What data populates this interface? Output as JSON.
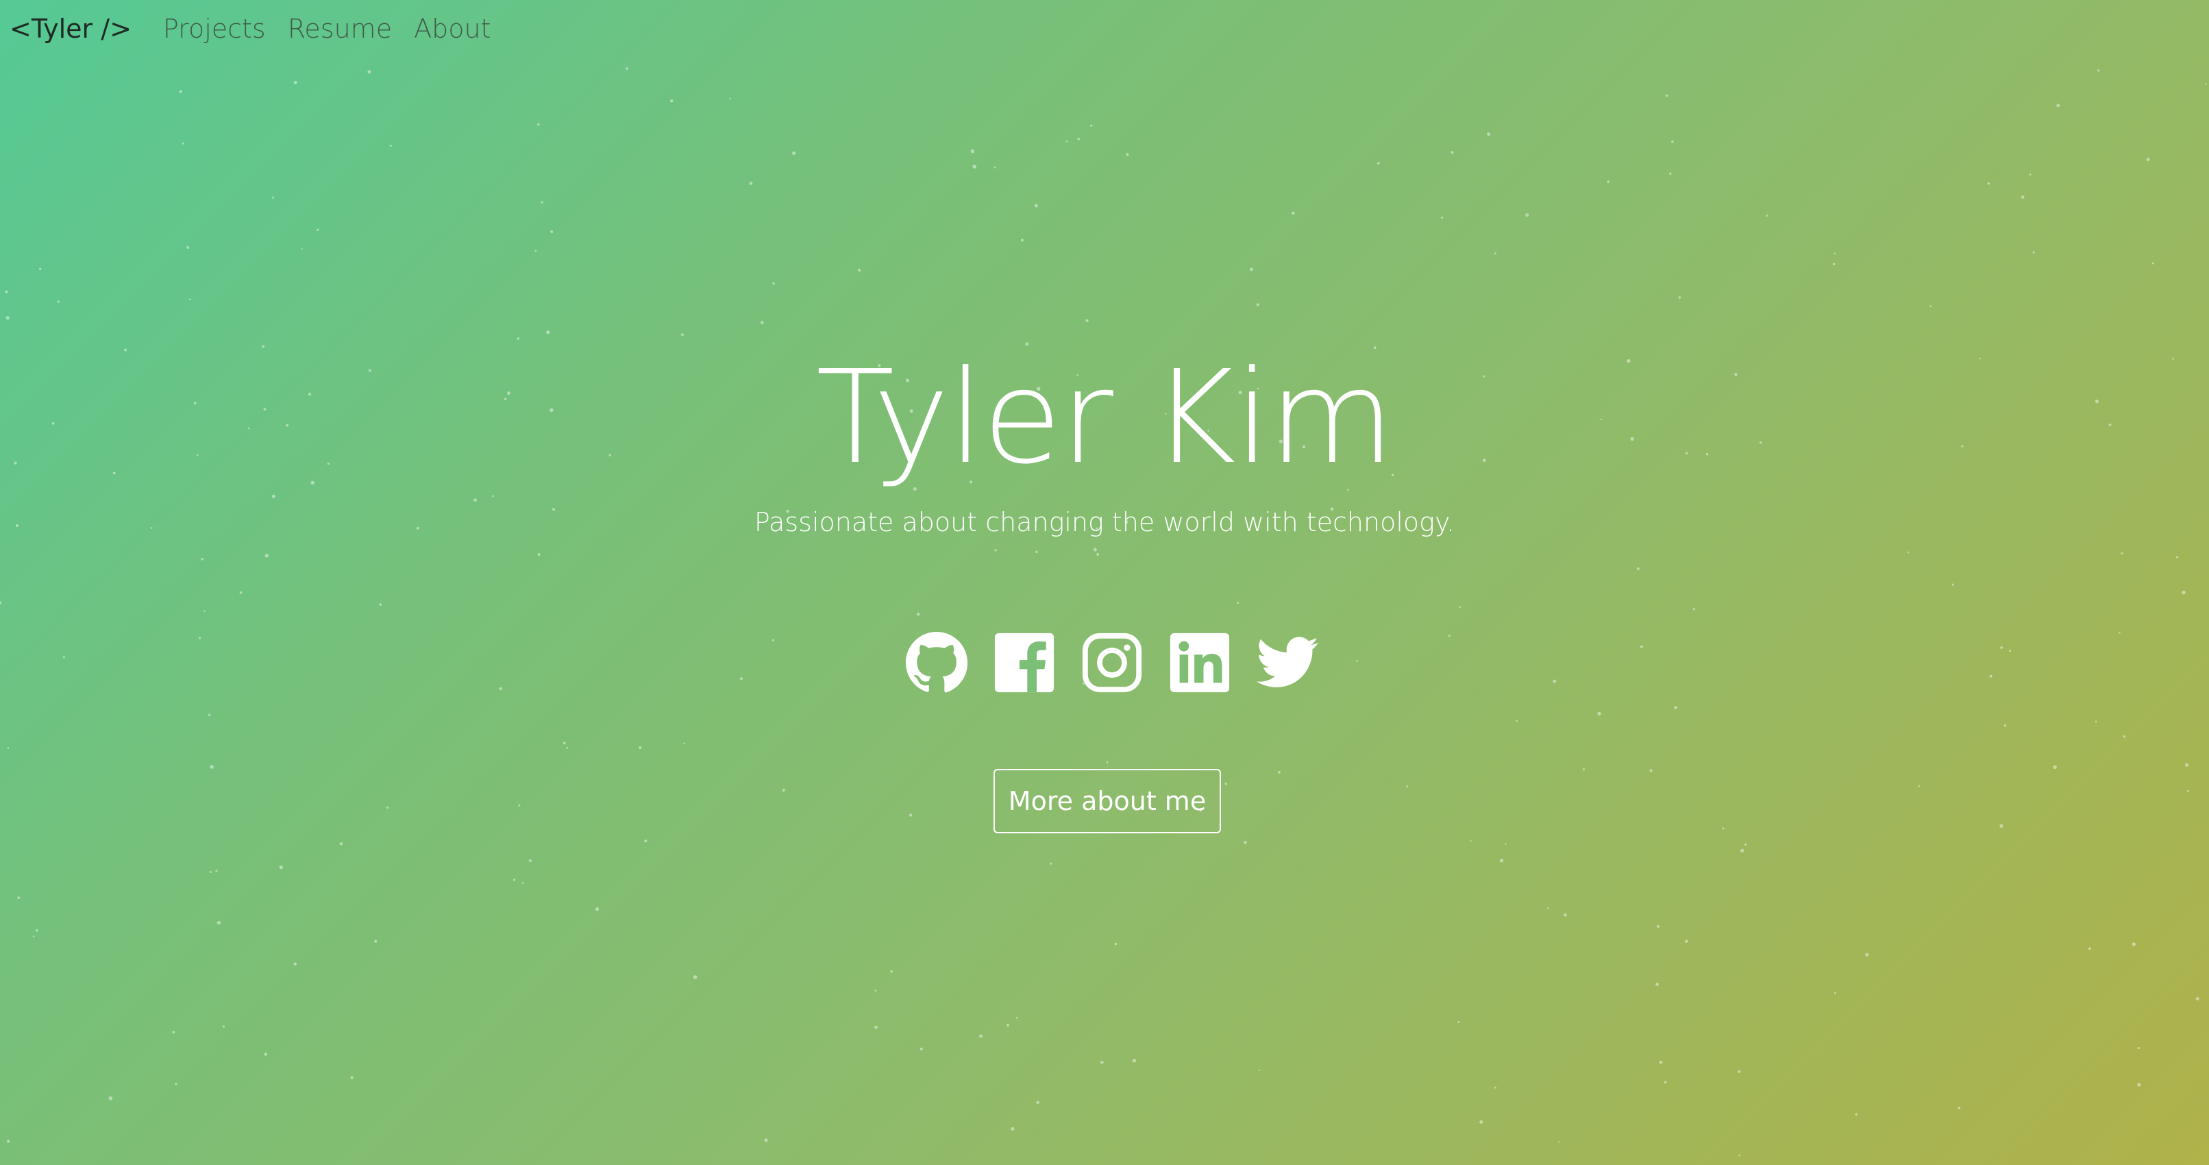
{
  "nav": {
    "brand": "<Tyler />",
    "links": [
      "Projects",
      "Resume",
      "About"
    ]
  },
  "hero": {
    "title": "Tyler Kim",
    "subtitle": "Passionate about changing the world with technology.",
    "cta_label": "More about me"
  },
  "social": [
    {
      "name": "github-icon"
    },
    {
      "name": "facebook-icon"
    },
    {
      "name": "instagram-icon"
    },
    {
      "name": "linkedin-icon"
    },
    {
      "name": "twitter-icon"
    }
  ],
  "colors": {
    "gradient_start": "#56c995",
    "gradient_end": "#b0b24a",
    "text": "#ffffff",
    "brand_text": "#1f2a26"
  }
}
